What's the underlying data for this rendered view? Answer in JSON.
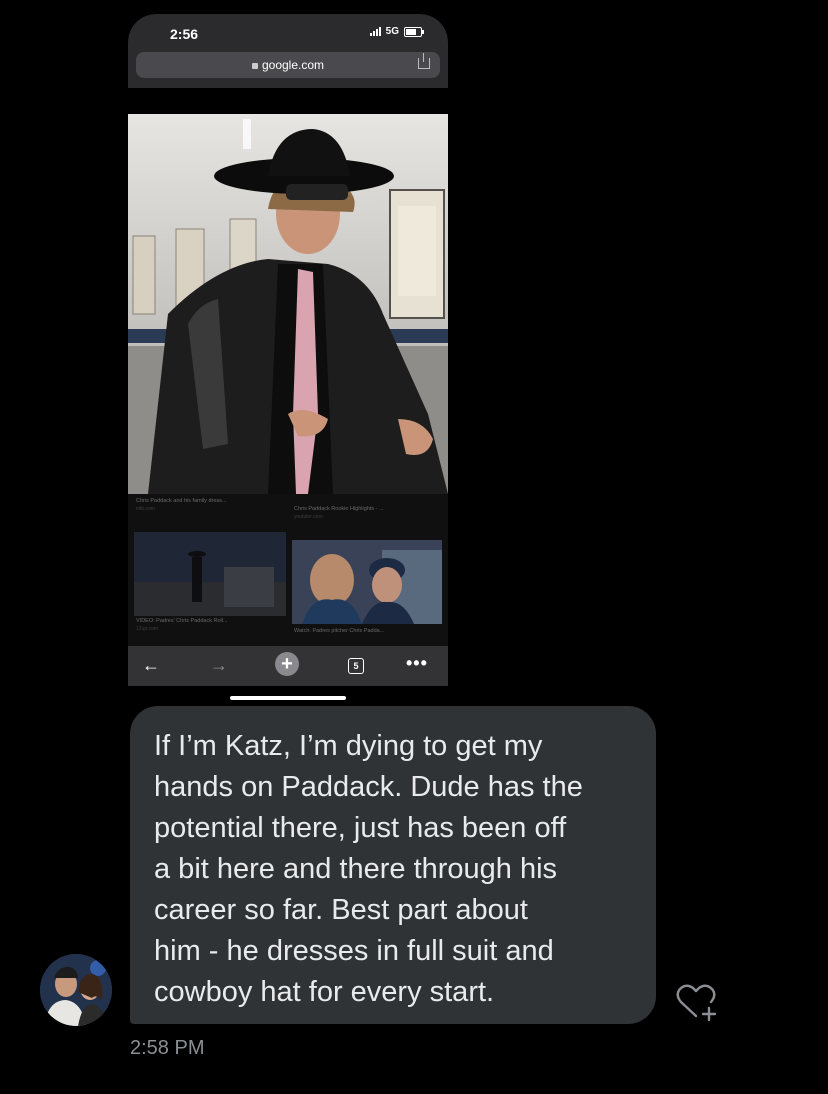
{
  "screenshot": {
    "status_time": "2:56",
    "network": "5G",
    "url": "google.com",
    "icons": [
      "lock-icon",
      "share-icon",
      "back-arrow-icon",
      "forward-arrow-icon",
      "new-tab-plus-icon",
      "tabs-count-icon",
      "more-icon"
    ],
    "tab_count": "5",
    "results": [
      {
        "caption": "Chris Paddack and his family dress...",
        "source": "mlb.com"
      },
      {
        "caption": "Chris Paddack Rookie Highlights - ...",
        "source": "youtube.com"
      },
      {
        "caption": "VIDEO: Padres' Chris Paddack Roll...",
        "source": "12up.com"
      },
      {
        "caption": "Watch: Padres pitcher Chris Padda...",
        "source": ""
      }
    ]
  },
  "message": {
    "text": "If I’m Katz, I’m dying to get my\nhands on Paddack. Dude has the\npotential there, just has been off\na bit here and there through his\ncareer so far. Best part about\nhim - he dresses in full suit and\ncowboy hat for every start.",
    "time": "2:58 PM"
  },
  "colors": {
    "bubble": "#2f3336",
    "background": "#000000",
    "text": "#e9eaeb",
    "timestamp": "#8b8f93"
  }
}
